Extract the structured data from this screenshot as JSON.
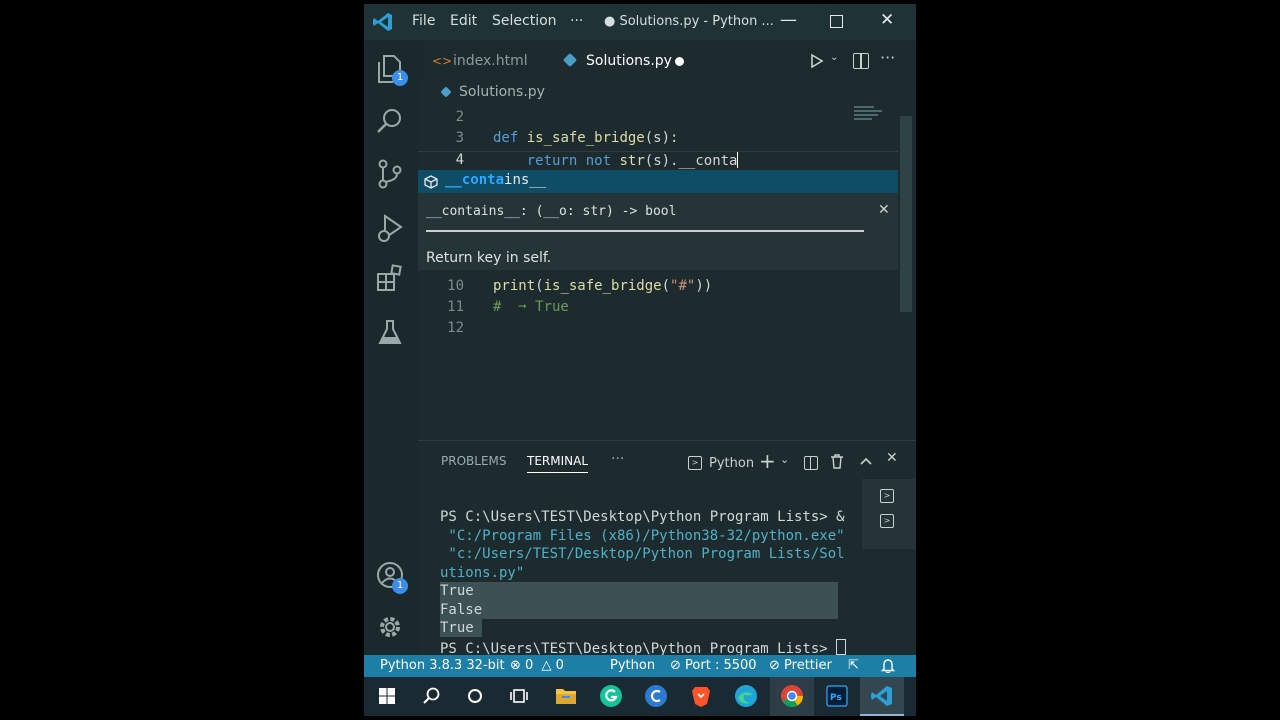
{
  "titlebar": {
    "menu": [
      "File",
      "Edit",
      "Selection",
      "···"
    ],
    "title": "● Solutions.py - Python ..."
  },
  "activity": {
    "explorer_badge": "1",
    "account_badge": "1"
  },
  "tabs": [
    {
      "label": "index.html",
      "active": false
    },
    {
      "label": "Solutions.py",
      "active": true,
      "dirty": true
    }
  ],
  "breadcrumb": {
    "file": "Solutions.py"
  },
  "editor": {
    "lines": [
      {
        "num": "2",
        "text": ""
      },
      {
        "num": "3",
        "text": "def is_safe_bridge(s):"
      },
      {
        "num": "4",
        "text": "    return not str(s).__conta"
      },
      {
        "num": "10",
        "text": "print(is_safe_bridge(\"#\"))"
      },
      {
        "num": "11",
        "text": "#  ➞ True"
      },
      {
        "num": "12",
        "text": ""
      }
    ]
  },
  "suggest": {
    "item_match": "conta",
    "item_prefix": "__",
    "item_rest": "ins__",
    "signature": "__contains__: (__o: str) -> bool",
    "doc": "Return key in self."
  },
  "panel": {
    "tabs": [
      "PROBLEMS",
      "TERMINAL",
      "···"
    ],
    "shell": "Python",
    "terminal_lines": [
      "PS C:\\Users\\TEST\\Desktop\\Python Program Lists> &",
      " \"C:/Program Files (x86)/Python38-32/python.exe\"",
      " \"c:/Users/TEST/Desktop/Python Program Lists/Sol",
      "utions.py\""
    ],
    "output": [
      "True",
      "False",
      "True"
    ],
    "prompt": "PS C:\\Users\\TEST\\Desktop\\Python Program Lists> "
  },
  "status": {
    "interpreter": "Python 3.8.3 32-bit",
    "errors": "0",
    "warnings": "0",
    "language": "Python",
    "port": "Port : 5500",
    "prettier": "Prettier"
  },
  "colors": {
    "status_bar": "#1e7fa6",
    "suggest_highlight": "#0f4c66",
    "keyword": "#569cd6",
    "function": "#dcdcaa",
    "string": "#ce9178",
    "comment": "#6a9955"
  }
}
